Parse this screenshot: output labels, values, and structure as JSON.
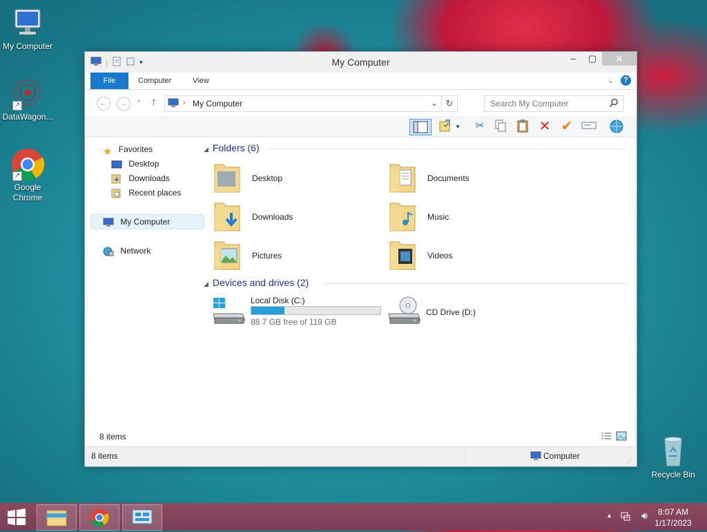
{
  "desktop": {
    "icons": [
      {
        "label": "My Computer"
      },
      {
        "label": "DataWagon..."
      },
      {
        "label": "Google Chrome"
      },
      {
        "label": "Recycle Bin"
      }
    ]
  },
  "window": {
    "title": "My Computer",
    "ribbon_tabs": [
      "File",
      "Computer",
      "View"
    ],
    "address": "My Computer",
    "search_placeholder": "Search My Computer",
    "sidebar": {
      "favorites": "Favorites",
      "favorites_items": [
        "Desktop",
        "Downloads",
        "Recent places"
      ],
      "my_computer": "My Computer",
      "network": "Network"
    },
    "groups": {
      "folders_title": "Folders (6)",
      "folders": [
        "Desktop",
        "Documents",
        "Downloads",
        "Music",
        "Pictures",
        "Videos"
      ],
      "devices_title": "Devices and drives (2)",
      "drives": [
        {
          "name": "Local Disk (C:)",
          "free": "88.7 GB free of 119 GB",
          "used_fraction": 0.255
        },
        {
          "name": "CD Drive (D:)"
        }
      ]
    },
    "items_count": "8 items",
    "status_left": "8 items",
    "status_right": "Computer"
  },
  "taskbar": {
    "time": "8:07 AM",
    "date": "1/17/2023"
  },
  "colors": {
    "accent": "#1979ca",
    "drive_bar": "#26a0da",
    "group_title": "#1e3287"
  }
}
